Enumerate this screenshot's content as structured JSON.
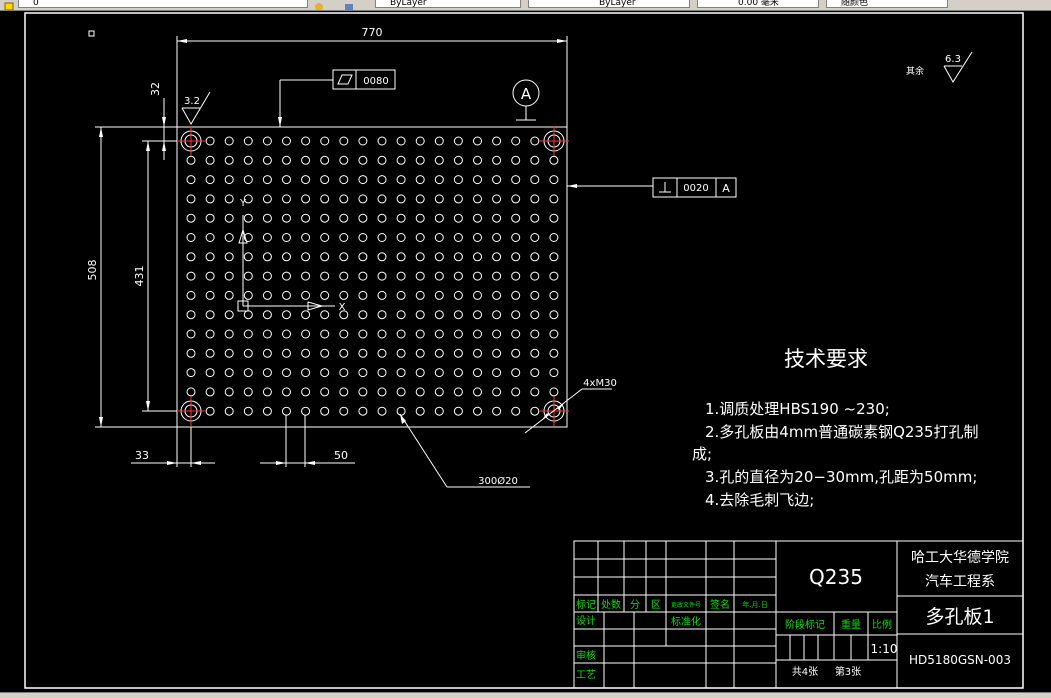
{
  "toolbar": {
    "field1": "0",
    "field2": "ByLayer",
    "field3": "ByLayer",
    "field4": "0.00 毫米",
    "field5": "随颜色"
  },
  "drawing": {
    "dims": {
      "top_width": "770",
      "height_outer": "508",
      "height_inner": "431",
      "top_offset": "32",
      "left_offset": "33",
      "pitch": "50",
      "hole_callout": "300Ø20",
      "corner_callout": "4xM30"
    },
    "tolerances": {
      "flatness_value": "0080",
      "perp_value": "0020",
      "perp_datum": "A",
      "datum_label": "A"
    },
    "roughness": {
      "top_value": "3.2",
      "rest_label": "其余",
      "rest_value": "6.3"
    },
    "ucs": {
      "x_label": "X",
      "y_label": "Y"
    },
    "tech": {
      "title": "技术要求",
      "line1": "1.调质处理HBS190 ~230;",
      "line2a": "2.多孔板由4mm普通碳素钢Q235打孔制",
      "line2b": "成;",
      "line3": "3.孔的直径为20−30mm,孔距为50mm;",
      "line4": "4.去除毛刺飞边;"
    },
    "titleblock": {
      "material": "Q235",
      "school": "哈工大华德学院",
      "dept": "汽车工程系",
      "part_name": "多孔板1",
      "drawing_no": "HD5180GSN-003",
      "scale": "1:10",
      "total_sheets": "共4张",
      "sheet_no": "第3张",
      "h_biaoji": "标记",
      "h_chushu": "处数",
      "h_fen": "分",
      "h_qu": "区",
      "h_gengai": "更改文件号",
      "h_qianming": "签名",
      "h_date": "年.月.日",
      "h_sheji": "设计",
      "h_biaozhunhua": "标准化",
      "h_shenhe": "审核",
      "h_gongyi": "工艺",
      "h_jieduan": "阶段标记",
      "h_zhongliang": "重量",
      "h_bili": "比例"
    }
  }
}
